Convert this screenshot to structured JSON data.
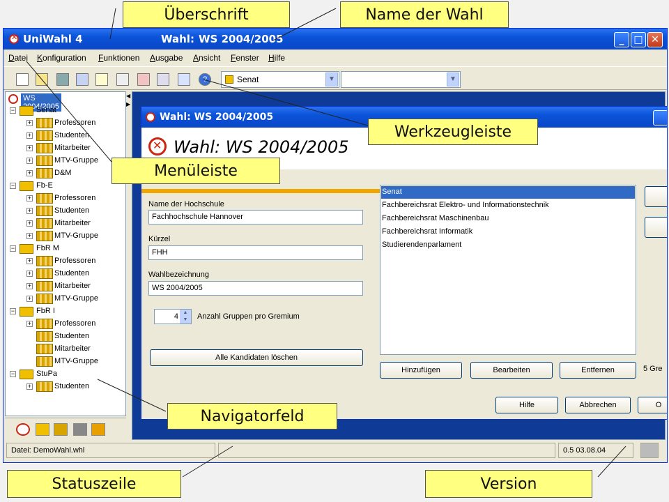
{
  "callouts": {
    "ueberschrift": "Überschrift",
    "name_der_wahl": "Name der Wahl",
    "werkzeugleiste": "Werkzeugleiste",
    "menueleiste": "Menüleiste",
    "navigatorfeld": "Navigatorfeld",
    "statuszeile": "Statuszeile",
    "version": "Version"
  },
  "window": {
    "app_title": "UniWahl 4",
    "wahl_label": "Wahl:",
    "wahl_value": "WS 2004/2005",
    "controls": {
      "minimize": "_",
      "maximize": "□",
      "close": "✕"
    }
  },
  "menu": [
    "Datei",
    "Konfiguration",
    "Funktionen",
    "Ausgabe",
    "Ansicht",
    "Fenster",
    "Hilfe"
  ],
  "toolbar": {
    "gremium_combo": "Senat",
    "second_combo": ""
  },
  "tree": {
    "root": "WS 2004/2005",
    "groups": [
      {
        "name": "Senat",
        "items": [
          "Professoren",
          "Studenten",
          "Mitarbeiter",
          "MTV-Gruppe",
          "D&M"
        ]
      },
      {
        "name": "Fb-E",
        "items": [
          "Professoren",
          "Studenten",
          "Mitarbeiter",
          "MTV-Gruppe"
        ]
      },
      {
        "name": "FbR M",
        "items": [
          "Professoren",
          "Studenten",
          "Mitarbeiter",
          "MTV-Gruppe"
        ]
      },
      {
        "name": "FbR I",
        "items": [
          "Professoren",
          "Studenten",
          "Mitarbeiter",
          "MTV-Gruppe"
        ]
      },
      {
        "name": "StuPa",
        "items": [
          "Studenten"
        ]
      }
    ]
  },
  "child": {
    "title": "Wahl: WS 2004/2005",
    "header_title": "Wahl: WS 2004/2005",
    "hochschule_label": "Name der Hochschule",
    "hochschule_value": "Fachhochschule Hannover",
    "kuerzel_label": "Kürzel",
    "kuerzel_value": "FHH",
    "wahlbez_label": "Wahlbezeichnung",
    "wahlbez_value": "WS 2004/2005",
    "gruppen_value": "4",
    "gruppen_label": "Anzahl Gruppen pro Gremium",
    "alle_loeschen": "Alle Kandidaten löschen",
    "gremien": [
      "Senat",
      "Fachbereichsrat Elektro- und Informationstechnik",
      "Fachbereichsrat Maschinenbau",
      "Fachbereichsrat Informatik",
      "Studierendenparlament"
    ],
    "hinzufuegen": "Hinzufügen",
    "bearbeiten": "Bearbeiten",
    "entfernen": "Entfernen",
    "gremien_count": "5 Gre",
    "hilfe": "Hilfe",
    "abbrechen": "Abbrechen",
    "ok_partial": "O"
  },
  "status": {
    "file": "Datei: DemoWahl.whl",
    "middle": "",
    "version": "0.5 03.08.04"
  }
}
